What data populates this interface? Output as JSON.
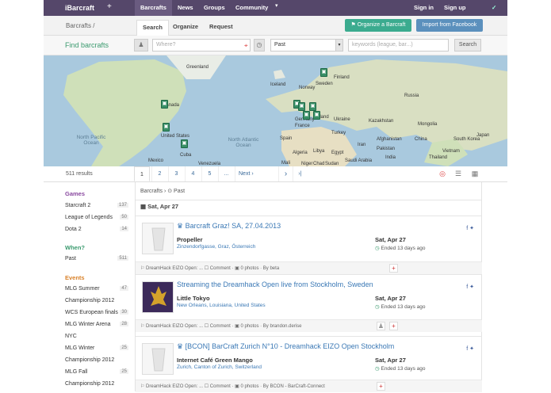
{
  "topbar": {
    "brand": "iBarcraft",
    "plus": "+",
    "nav": [
      "Barcrafts",
      "News",
      "Groups",
      "Community"
    ],
    "caret": "▾",
    "signin": "Sign in",
    "signup": "Sign up",
    "bird": "✓"
  },
  "subbar": {
    "crumb": "Barcrafts /",
    "tabs": [
      "Search",
      "Organize",
      "Request"
    ],
    "organize_btn": "Organize a Barcraft",
    "import_btn": "Import from Facebook",
    "flag_icon": "⚑"
  },
  "search": {
    "title": "Find barcrafts",
    "where_placeholder": "Where?",
    "time_value": "Past",
    "keywords_placeholder": "keywords (league, bar...)",
    "button": "Search"
  },
  "map": {
    "labels": [
      "Iceland",
      "Sweden",
      "Finland",
      "Norway",
      "Russia",
      "Kazakhstan",
      "Mongolia",
      "China",
      "Japan",
      "India",
      "Iran",
      "Turkey",
      "Ukraine",
      "Poland",
      "Germany",
      "France",
      "Spain",
      "Algeria",
      "Libya",
      "Egypt",
      "Saudi Arabia",
      "Mali",
      "Niger",
      "Chad",
      "Sudan",
      "Canada",
      "United States",
      "Mexico",
      "Cuba",
      "Venezuela",
      "Greenland",
      "Afghanistan",
      "Pakistan",
      "South Korea",
      "Thailand",
      "Vietnam"
    ],
    "oceans": [
      "North Pacific Ocean",
      "North Atlantic Ocean"
    ],
    "pin_icon": "▣"
  },
  "pager": {
    "count": "511 results",
    "pages": [
      "1",
      "2",
      "3",
      "4",
      "5",
      "...",
      "Next ›"
    ],
    "next_arrow": "›",
    "last_arrow": "›|"
  },
  "sidebar": {
    "games_head": "Games",
    "games": [
      {
        "label": "Starcraft 2",
        "count": "137"
      },
      {
        "label": "League of Legends",
        "count": "50"
      },
      {
        "label": "Dota 2",
        "count": "14"
      }
    ],
    "when_head": "When?",
    "when": [
      {
        "label": "Past",
        "count": "511"
      }
    ],
    "events_head": "Events",
    "events": [
      {
        "label": "MLG Summer",
        "count": "47"
      },
      {
        "label": "Championship 2012",
        "count": ""
      },
      {
        "label": "WCS European finals",
        "count": "30"
      },
      {
        "label": "MLG Winter Arena",
        "count": "28"
      },
      {
        "label": "NYC",
        "count": ""
      },
      {
        "label": "MLG Winter",
        "count": "25"
      },
      {
        "label": "Championship 2012",
        "count": ""
      },
      {
        "label": "MLG Fall",
        "count": "25"
      },
      {
        "label": "Championship 2012",
        "count": ""
      }
    ],
    "colors": {
      "games": "#8a4aa0",
      "when": "#3a9a6e",
      "events": "#d9822b"
    }
  },
  "main": {
    "breadcrumb": "Barcrafts › ⊙ Past",
    "date_header": "Sat, Apr 27",
    "cards": [
      {
        "title": "Barcraft Graz! SA, 27.04.2013",
        "place": "Propeller",
        "address": "Zinzendorfgasse, Graz, Österreich",
        "date": "Sat, Apr 27",
        "ended": "Ended 13 days ago",
        "footer": "⚐ DreamHack EIZO Open: ...   ☐ Comment  ·  ▣ 0 photos  ·  By beta",
        "social": "f ✦"
      },
      {
        "title": "Streaming the Dreamhack Open live from Stockholm, Sweden",
        "place": "Little Tokyo",
        "address": "New Orleans, Louisiana, United States",
        "date": "Sat, Apr 27",
        "ended": "Ended 13 days ago",
        "footer": "⚐ DreamHack EIZO Open: ...   ☐ Comment  ·  ▣ 0 photos  ·  By brandon.derise",
        "social": "f ✦"
      },
      {
        "title": "[BCON] BarCraft Zurich N°10 - Dreamhack EIZO Open Stockholm",
        "place": "Internet Café Green Mango",
        "address": "Zurich, Canton of Zurich, Switzerland",
        "date": "Sat, Apr 27",
        "ended": "Ended 13 days ago",
        "footer": "⚐ DreamHack EIZO Open: ...   ☐ Comment  ·  ▣ 0 photos  ·  By BCON - BarCraft-Connect",
        "social": "f ✦"
      }
    ]
  }
}
